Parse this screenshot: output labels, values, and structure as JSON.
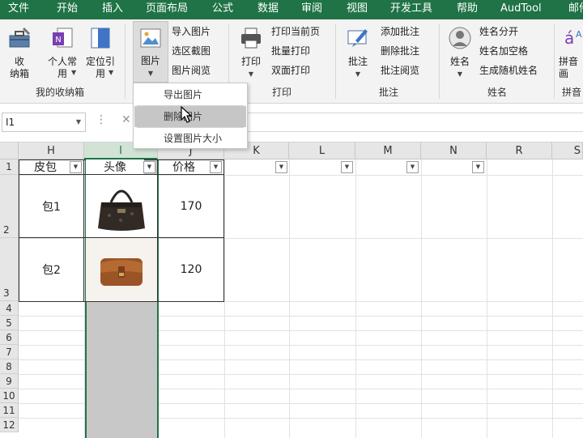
{
  "menu": [
    "文件",
    "开始",
    "插入",
    "页面布局",
    "公式",
    "数据",
    "审阅",
    "视图",
    "开发工具",
    "帮助",
    "AudTool",
    "邮件"
  ],
  "ribbon": {
    "group_storage": {
      "label": "我的收纳箱",
      "btn_box": "收\n纳箱",
      "btn_personal": "个人常\n用",
      "btn_locate": "定位引\n用"
    },
    "group_image": {
      "btn_image": "图片",
      "import_image": "导入图片",
      "region_capture": "选区截图",
      "image_browse": "图片阅览"
    },
    "group_print": {
      "label": "打印",
      "btn_print": "打印",
      "print_current": "打印当前页",
      "batch_print": "批量打印",
      "duplex_print": "双面打印"
    },
    "group_comment": {
      "label": "批注",
      "btn_comment": "批注",
      "add_comment": "添加批注",
      "delete_comment": "删除批注",
      "comment_browse": "批注阅览"
    },
    "group_name": {
      "label": "姓名",
      "btn_name": "姓名",
      "split_name": "姓名分开",
      "name_space": "姓名加空格",
      "random_name": "生成随机姓名"
    },
    "group_pinyin": {
      "label": "拼音",
      "btn_pinyin": "拼音\n画"
    }
  },
  "dropdown": {
    "items": [
      "导出图片",
      "删除图片",
      "设置图片大小"
    ],
    "highlighted": 1
  },
  "formula_bar": {
    "name_box": "I1",
    "fx_symbol": "✕"
  },
  "columns": [
    "H",
    "I",
    "J",
    "K",
    "L",
    "M",
    "N",
    "R",
    "S"
  ],
  "selected_column": "I",
  "rows": [
    "1",
    "2",
    "3",
    "4",
    "5",
    "6",
    "7",
    "8",
    "9",
    "10",
    "11",
    "12"
  ],
  "table": {
    "headers": [
      "皮包",
      "头像",
      "价格"
    ],
    "rows": [
      {
        "name": "包1",
        "price": "170"
      },
      {
        "name": "包2",
        "price": "120"
      }
    ]
  },
  "colors": {
    "menu_bg": "#1f7346",
    "selection": "#217346"
  }
}
